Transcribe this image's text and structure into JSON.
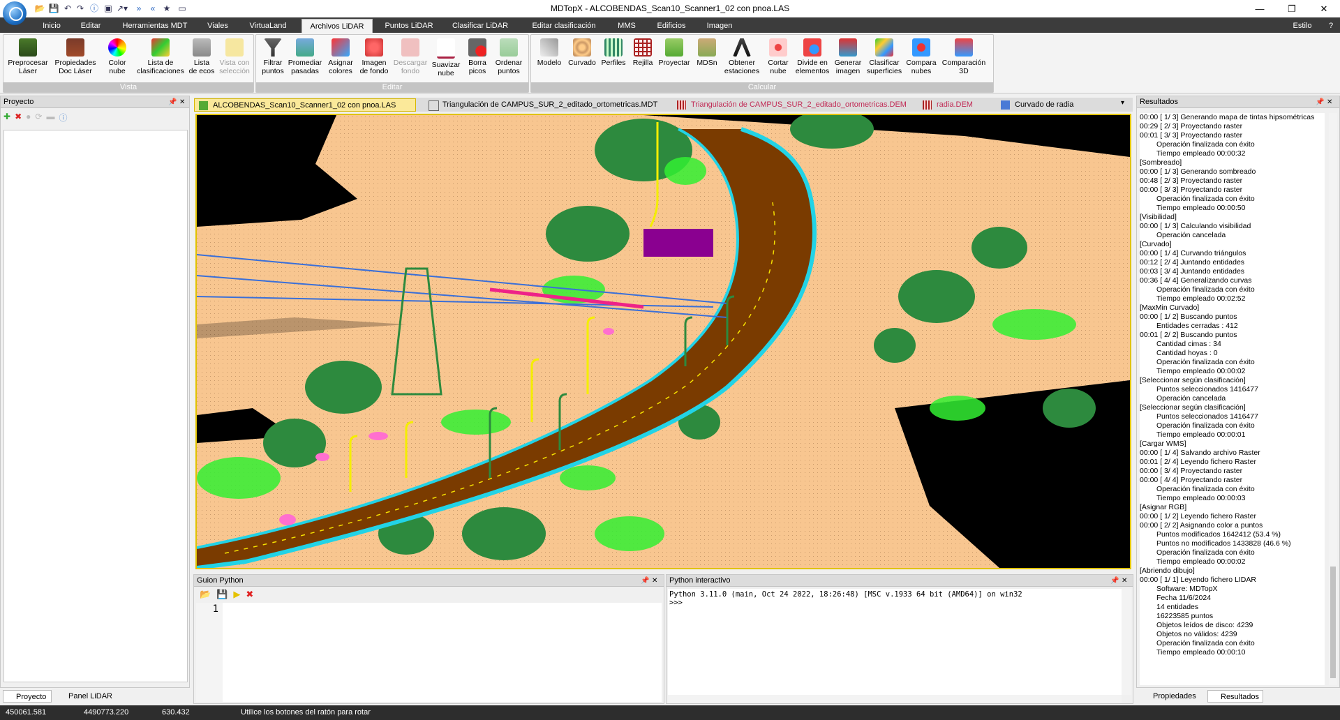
{
  "window": {
    "title": "MDTopX - ALCOBENDAS_Scan10_Scanner1_02 con pnoa.LAS"
  },
  "menu_tabs": [
    "Inicio",
    "Editar",
    "Herramientas MDT",
    "Viales",
    "VirtuaLand",
    "Archivos LiDAR",
    "Puntos LiDAR",
    "Clasificar LiDAR",
    "Editar clasificación",
    "MMS",
    "Edificios",
    "Imagen"
  ],
  "active_tab": "Archivos LiDAR",
  "style_menu": "Estilo",
  "ribbon": {
    "vista": {
      "label": "Vista",
      "buttons": [
        {
          "label": "Preprocesar\nLáser"
        },
        {
          "label": "Propiedades\nDoc Láser"
        },
        {
          "label": "Color\nnube"
        },
        {
          "label": "Lista de\nclasificaciones"
        },
        {
          "label": "Lista\nde ecos"
        },
        {
          "label": "Vista con\nselección"
        }
      ]
    },
    "editar": {
      "label": "Editar",
      "buttons": [
        {
          "label": "Filtrar\npuntos"
        },
        {
          "label": "Promediar\npasadas"
        },
        {
          "label": "Asignar\ncolores"
        },
        {
          "label": "Imagen\nde fondo"
        },
        {
          "label": "Descargar\nfondo"
        },
        {
          "label": "Suavizar\nnube"
        },
        {
          "label": "Borra\npicos"
        },
        {
          "label": "Ordenar\npuntos"
        }
      ]
    },
    "calcular": {
      "label": "Calcular",
      "buttons": [
        {
          "label": "Modelo\n "
        },
        {
          "label": "Curvado\n "
        },
        {
          "label": "Perfiles\n "
        },
        {
          "label": "Rejilla\n "
        },
        {
          "label": "Proyectar\n "
        },
        {
          "label": "MDSn\n "
        },
        {
          "label": "Obtener\nestaciones"
        },
        {
          "label": "Cortar\nnube"
        },
        {
          "label": "Divide en\nelementos"
        },
        {
          "label": "Generar\nimagen"
        },
        {
          "label": "Clasificar\nsuperficies"
        },
        {
          "label": "Compara\nnubes"
        },
        {
          "label": "Comparación\n3D"
        }
      ]
    }
  },
  "panels": {
    "project": "Proyecto",
    "results": "Resultados",
    "guion": "Guion Python",
    "python": "Python interactivo"
  },
  "doc_tabs": [
    "ALCOBENDAS_Scan10_Scanner1_02 con pnoa.LAS",
    "Triangulación de CAMPUS_SUR_2_editado_ortometricas.MDT",
    "Triangulación de CAMPUS_SUR_2_editado_ortometricas.DEM",
    "radia.DEM",
    "Curvado de radia"
  ],
  "results": [
    {
      "t": "00:00 [ 1/ 3] Generando mapa de tintas hipsométricas",
      "i": 0
    },
    {
      "t": "00:29 [ 2/ 3] Proyectando raster",
      "i": 0
    },
    {
      "t": "00:01 [ 3/ 3] Proyectando raster",
      "i": 0
    },
    {
      "t": "Operación finalizada con éxito",
      "i": 1
    },
    {
      "t": "Tiempo empleado 00:00:32",
      "i": 1
    },
    {
      "t": "[Sombreado]",
      "i": 0
    },
    {
      "t": "00:00 [ 1/ 3] Generando sombreado",
      "i": 0
    },
    {
      "t": "00:48 [ 2/ 3] Proyectando raster",
      "i": 0
    },
    {
      "t": "00:00 [ 3/ 3] Proyectando raster",
      "i": 0
    },
    {
      "t": "Operación finalizada con éxito",
      "i": 1
    },
    {
      "t": "Tiempo empleado 00:00:50",
      "i": 1
    },
    {
      "t": "[Visibilidad]",
      "i": 0
    },
    {
      "t": "00:00 [ 1/ 3] Calculando visibilidad",
      "i": 0
    },
    {
      "t": "Operación cancelada",
      "i": 1
    },
    {
      "t": "[Curvado]",
      "i": 0
    },
    {
      "t": "00:00 [ 1/ 4] Curvando triángulos",
      "i": 0
    },
    {
      "t": "00:12 [ 2/ 4] Juntando entidades",
      "i": 0
    },
    {
      "t": "00:03 [ 3/ 4] Juntando entidades",
      "i": 0
    },
    {
      "t": "00:36 [ 4/ 4] Generalizando curvas",
      "i": 0
    },
    {
      "t": "Operación finalizada con éxito",
      "i": 1
    },
    {
      "t": "Tiempo empleado 00:02:52",
      "i": 1
    },
    {
      "t": "[MaxMin Curvado]",
      "i": 0
    },
    {
      "t": "00:00 [ 1/ 2] Buscando puntos",
      "i": 0
    },
    {
      "t": "Entidades cerradas : 412",
      "i": 1
    },
    {
      "t": "00:01 [ 2/ 2] Buscando puntos",
      "i": 0
    },
    {
      "t": "Cantidad cimas : 34",
      "i": 1
    },
    {
      "t": "Cantidad hoyas : 0",
      "i": 1
    },
    {
      "t": "Operación finalizada con éxito",
      "i": 1
    },
    {
      "t": "Tiempo empleado 00:00:02",
      "i": 1
    },
    {
      "t": "[Seleccionar según clasificación]",
      "i": 0
    },
    {
      "t": "Puntos seleccionados 1416477",
      "i": 1
    },
    {
      "t": "Operación cancelada",
      "i": 1
    },
    {
      "t": "[Seleccionar según clasificación]",
      "i": 0
    },
    {
      "t": "Puntos seleccionados 1416477",
      "i": 1
    },
    {
      "t": "Operación finalizada con éxito",
      "i": 1
    },
    {
      "t": "Tiempo empleado 00:00:01",
      "i": 1
    },
    {
      "t": "[Cargar WMS]",
      "i": 0
    },
    {
      "t": "00:00 [ 1/ 4] Salvando archivo Raster",
      "i": 0
    },
    {
      "t": "00:01 [ 2/ 4] Leyendo fichero Raster",
      "i": 0
    },
    {
      "t": "00:00 [ 3/ 4] Proyectando raster",
      "i": 0
    },
    {
      "t": "00:00 [ 4/ 4] Proyectando raster",
      "i": 0
    },
    {
      "t": "Operación finalizada con éxito",
      "i": 1
    },
    {
      "t": "Tiempo empleado 00:00:03",
      "i": 1
    },
    {
      "t": "[Asignar RGB]",
      "i": 0
    },
    {
      "t": "00:00 [ 1/ 2] Leyendo fichero Raster",
      "i": 0
    },
    {
      "t": "00:00 [ 2/ 2] Asignando color a puntos",
      "i": 0
    },
    {
      "t": "Puntos modificados 1642412 (53.4 %)",
      "i": 1
    },
    {
      "t": "Puntos no modificados 1433828 (46.6 %)",
      "i": 1
    },
    {
      "t": "Operación finalizada con éxito",
      "i": 1
    },
    {
      "t": "Tiempo empleado 00:00:02",
      "i": 1
    },
    {
      "t": "[Abriendo dibujo]",
      "i": 0
    },
    {
      "t": "00:00 [ 1/ 1] Leyendo fichero LIDAR",
      "i": 0
    },
    {
      "t": "Software: MDTopX",
      "i": 1
    },
    {
      "t": "Fecha 11/6/2024",
      "i": 1
    },
    {
      "t": "14 entidades",
      "i": 1
    },
    {
      "t": "16223585 puntos",
      "i": 1
    },
    {
      "t": "Objetos leídos de disco: 4239",
      "i": 1
    },
    {
      "t": "Objetos no válidos: 4239",
      "i": 1
    },
    {
      "t": "Operación finalizada con éxito",
      "i": 1
    },
    {
      "t": "Tiempo empleado 00:00:10",
      "i": 1
    }
  ],
  "python": {
    "banner": "Python 3.11.0 (main, Oct 24 2022, 18:26:48) [MSC v.1933 64 bit (AMD64)] on win32",
    "prompt": ">>>",
    "line_number": "1"
  },
  "bottom_tabs": {
    "left": [
      "Proyecto",
      "Panel LiDAR"
    ],
    "right": [
      "Propiedades",
      "Resultados"
    ]
  },
  "status": {
    "x": "450061.581",
    "y": "4490773.220",
    "z": "630.432",
    "hint": "Utilice los botones del ratón para rotar"
  },
  "colors": {
    "accent": "#f5d400",
    "ground": "#f8c690",
    "road": "#7a3b00",
    "vegetation_dark": "#2d8a3e",
    "vegetation_light": "#33ee33",
    "cyan": "#22d3e6"
  }
}
